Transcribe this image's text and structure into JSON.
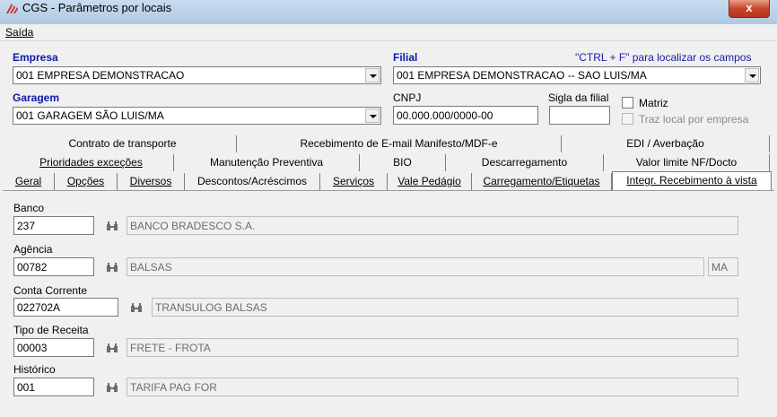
{
  "window": {
    "title": "CGS - Parâmetros por locais",
    "close": "x"
  },
  "menu": {
    "saida": "Saída"
  },
  "empresa": {
    "label": "Empresa",
    "value": "001 EMPRESA DEMONSTRACAO"
  },
  "filial": {
    "label": "Filial",
    "value": "001 EMPRESA DEMONSTRACAO -- SAO LUIS/MA"
  },
  "hint": "\"CTRL + F\" para localizar os campos",
  "garagem": {
    "label": "Garagem",
    "value": "001 GARAGEM SÃO LUIS/MA"
  },
  "cnpj": {
    "label": "CNPJ",
    "value": "00.000.000/0000-00"
  },
  "sigla": {
    "label": "Sigla da filial",
    "value": ""
  },
  "matriz": {
    "label": "Matriz",
    "checked": false
  },
  "traz_local": {
    "label": "Traz local por empresa",
    "checked": false,
    "disabled": true
  },
  "tabs": {
    "row1": [
      "Contrato de transporte",
      "Recebimento de E-mail Manifesto/MDF-e",
      "EDI / Averbação"
    ],
    "row2": [
      "Prioridades exceções",
      "Manutenção Preventiva",
      "BIO",
      "Descarregamento",
      "Valor limite NF/Docto"
    ],
    "row3": [
      "Geral",
      "Opções",
      "Diversos",
      "Descontos/Acréscimos",
      "Serviços",
      "Vale Pedágio",
      "Carregamento/Etiquetas",
      "Integr. Recebimento à vista"
    ],
    "active": "Integr. Recebimento à vista"
  },
  "form": {
    "banco": {
      "label": "Banco",
      "code": "237",
      "desc": "BANCO BRADESCO S.A."
    },
    "agencia": {
      "label": "Agência",
      "code": "00782",
      "desc": "BALSAS",
      "uf": "MA"
    },
    "conta": {
      "label": "Conta Corrente",
      "code": "022702A",
      "desc": "TRANSULOG BALSAS"
    },
    "receita": {
      "label": "Tipo de Receita",
      "code": "00003",
      "desc": "FRETE - FROTA"
    },
    "historico": {
      "label": "Histórico",
      "code": "001",
      "desc": "TARIFA PAG FOR"
    }
  },
  "colors": {
    "label_blue": "#0a1aa8",
    "titlebar": "#adc7e2",
    "close_red": "#c7452a"
  }
}
